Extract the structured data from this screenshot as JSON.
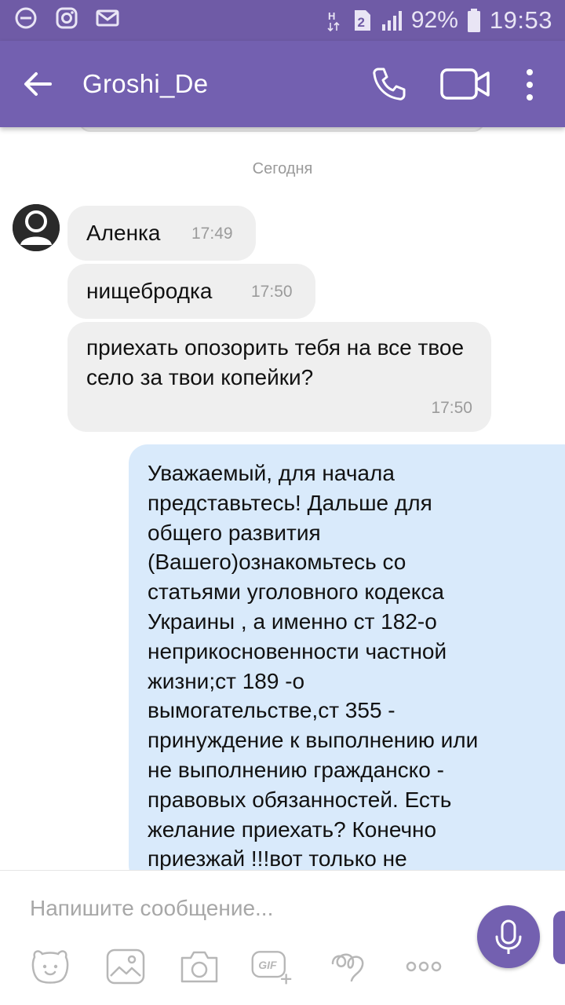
{
  "status_bar": {
    "network_label": "2",
    "battery_percent": "92%",
    "time": "19:53"
  },
  "header": {
    "title": "Groshi_De"
  },
  "chat": {
    "date_separator": "Сегодня",
    "messages": [
      {
        "direction": "incoming",
        "text": "Аленка",
        "time": "17:49"
      },
      {
        "direction": "incoming",
        "text": "нищебродка",
        "time": "17:50"
      },
      {
        "direction": "incoming",
        "text": "приехать опозорить тебя на все твое село за твои копейки?",
        "time": "17:50"
      },
      {
        "direction": "outgoing",
        "text": "Уважаемый, для начала\nпредставьтесь! Дальше для\nобщего развития\n(Вашего)ознакомьтесь со\nстатьями уголовного кодекса\nУкраины , а именно ст 182-о\nнеприкосновенности частной\nжизни;ст 189 -о\nвымогательстве,ст 355 -\nпринуждение к выполнению или\nне выполнению гражданско -\nправовых обязанностей. Есть\nжелание приехать? Конечно\nприезжай !!!вот только не"
      }
    ]
  },
  "composer": {
    "placeholder": "Напишите сообщение..."
  },
  "toolbar": {
    "gif_label": "GIF"
  },
  "colors": {
    "header": "#7360b0",
    "status_bar": "#6f5ba6",
    "incoming_bubble": "#efefef",
    "outgoing_bubble": "#d9eafb",
    "accent": "#7360b0"
  },
  "icons": [
    "dnd-icon",
    "instagram-icon",
    "mail-icon",
    "hd-icon",
    "sim-icon",
    "signal-icon",
    "battery-icon",
    "back-arrow-icon",
    "phone-icon",
    "video-icon",
    "more-vert-icon",
    "sticker-icon",
    "image-icon",
    "camera-icon",
    "gif-icon",
    "doodle-icon",
    "more-horiz-icon",
    "mic-icon"
  ]
}
